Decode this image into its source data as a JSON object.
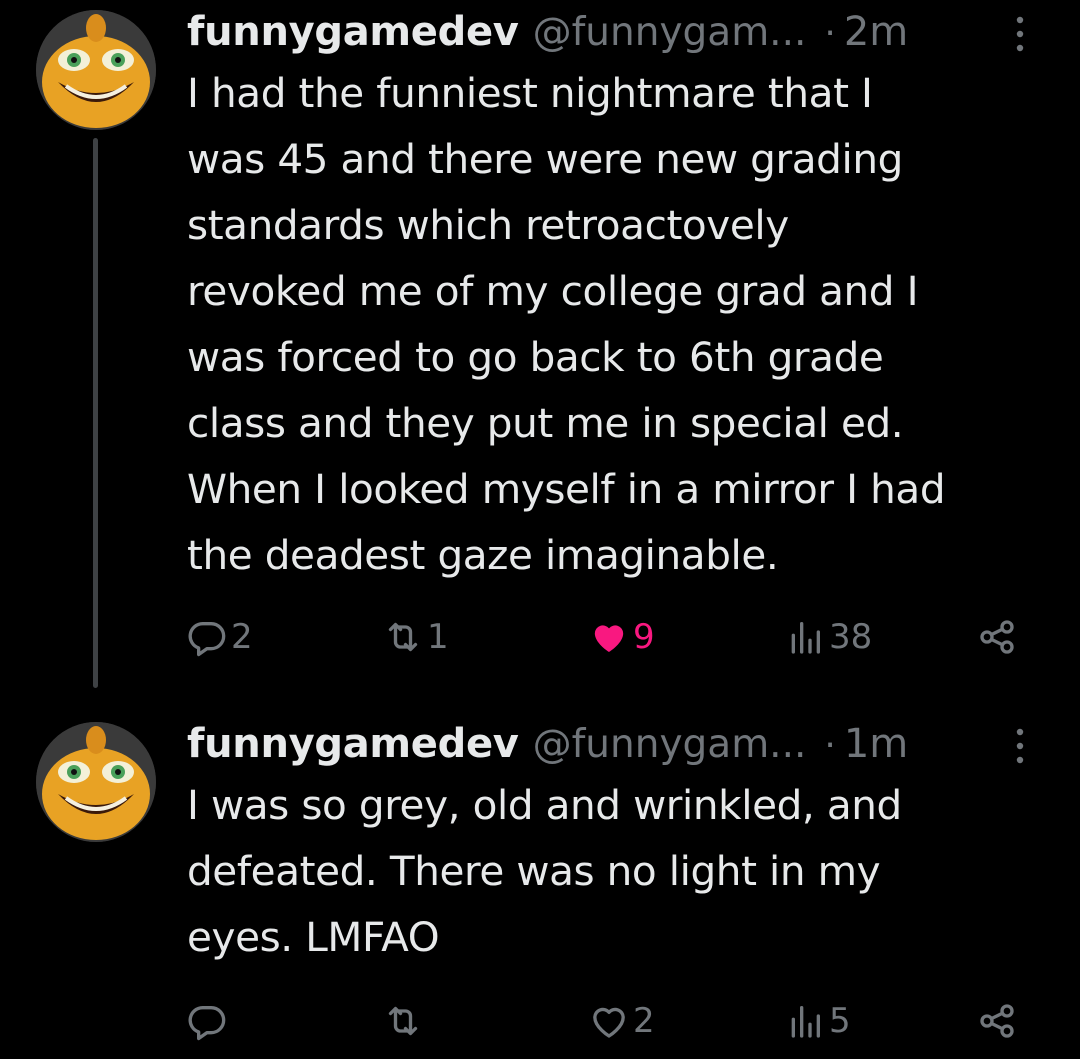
{
  "colors": {
    "background": "#000000",
    "text": "#e7e9ea",
    "muted": "#71767b",
    "like_active": "#f91880",
    "thread_line": "#3e4144"
  },
  "tweets": [
    {
      "display_name": "funnygamedev",
      "handle": "@funnygam...",
      "separator": "·",
      "time": "2m",
      "text": "I had the funniest nightmare that I\nwas 45 and there were new grading\nstandards which retroactovely\nrevoked me of my college grad and I\nwas forced to go back to 6th grade\nclass and they put me in special ed.\nWhen I looked myself in a mirror I had\nthe deadest gaze imaginable.",
      "actions": {
        "replies": "2",
        "retweets": "1",
        "likes": "9",
        "views": "38"
      },
      "liked": true,
      "icons": [
        "reply-icon",
        "retweet-icon",
        "heart-filled-icon",
        "views-icon",
        "share-icon"
      ]
    },
    {
      "display_name": "funnygamedev",
      "handle": "@funnygam...",
      "separator": "·",
      "time": "1m",
      "text": "I was so grey, old and wrinkled, and\ndefeated. There was no light in my\neyes. LMFAO",
      "actions": {
        "replies": "",
        "retweets": "",
        "likes": "2",
        "views": "5"
      },
      "liked": false,
      "icons": [
        "reply-icon",
        "retweet-icon",
        "heart-icon",
        "views-icon",
        "share-icon"
      ]
    }
  ]
}
